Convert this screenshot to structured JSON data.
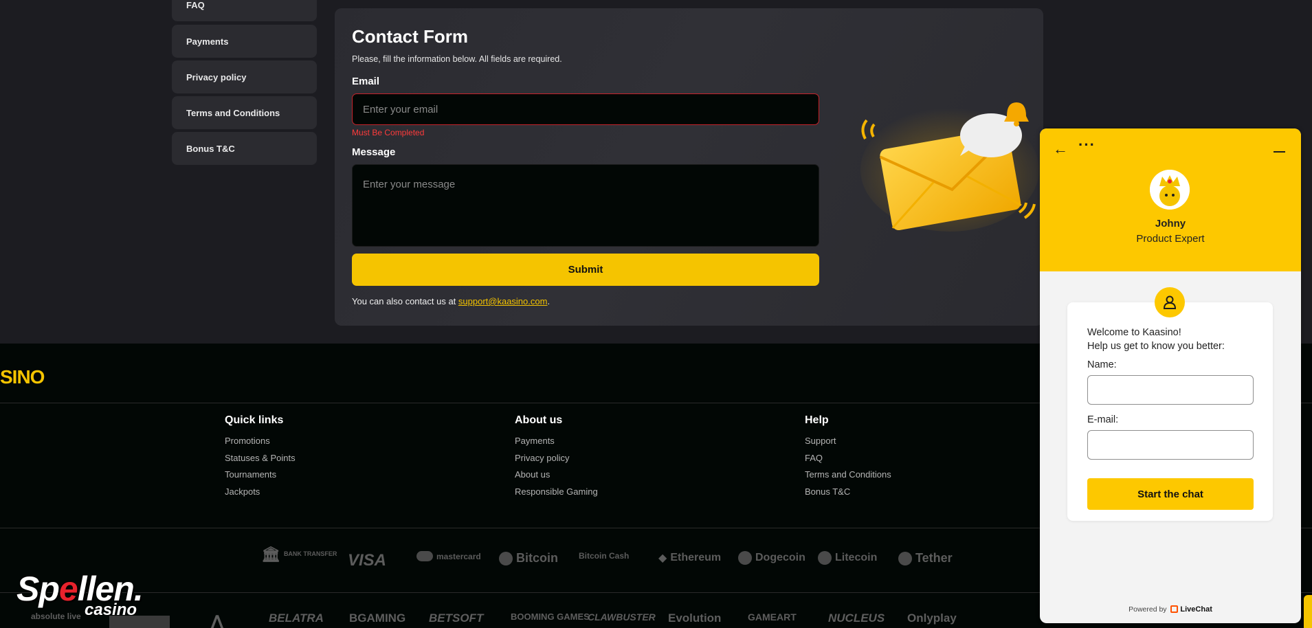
{
  "sidebar": {
    "items": [
      {
        "label": "FAQ"
      },
      {
        "label": "Payments"
      },
      {
        "label": "Privacy policy"
      },
      {
        "label": "Terms and Conditions"
      },
      {
        "label": "Bonus T&C"
      }
    ]
  },
  "contact_form": {
    "title": "Contact Form",
    "intro": "Please, fill the information below. All fields are required.",
    "email_label": "Email",
    "email_placeholder": "Enter your email",
    "email_error": "Must Be Completed",
    "message_label": "Message",
    "message_placeholder": "Enter your message",
    "submit_label": "Submit",
    "contact_note_prefix": "You can also contact us at ",
    "contact_email": "support@kaasino.com",
    "contact_note_suffix": "."
  },
  "footer": {
    "logo_text": "SINO",
    "columns": [
      {
        "title": "Quick links",
        "links": [
          "Promotions",
          "Statuses & Points",
          "Tournaments",
          "Jackpots"
        ]
      },
      {
        "title": "About us",
        "links": [
          "Payments",
          "Privacy policy",
          "About us",
          "Responsible Gaming"
        ]
      },
      {
        "title": "Help",
        "links": [
          "Support",
          "FAQ",
          "Terms and Conditions",
          "Bonus T&C"
        ]
      }
    ],
    "payment_methods": [
      "BANK TRANSFER",
      "VISA",
      "mastercard",
      "Bitcoin",
      "Bitcoin Cash",
      "Ethereum",
      "Dogecoin",
      "Litecoin",
      "Tether"
    ],
    "providers": [
      "absolute live",
      "BELATRA",
      "BGAMING",
      "BETSOFT",
      "BOOMING GAMES",
      "CLAWBUSTER",
      "Evolution",
      "GAMEART",
      "NUCLEUS",
      "Onlyplay"
    ]
  },
  "chat": {
    "agent_name": "Johny",
    "agent_role": "Product Expert",
    "welcome_line1": "Welcome to Kaasino!",
    "welcome_line2": "Help us get to know you better:",
    "name_label": "Name:",
    "email_label": "E-mail:",
    "start_button": "Start the chat",
    "powered_by": "Powered by",
    "powered_brand": "LiveChat",
    "icons": {
      "back": "arrow-left-icon",
      "more": "more-dots-icon",
      "minimize": "minimize-icon",
      "user": "user-icon"
    }
  },
  "overlay": {
    "brand_part1": "Sp",
    "brand_red": "e",
    "brand_part2": "llen.",
    "brand_sub": "casino"
  },
  "colors": {
    "accent": "#f5c400",
    "chat_accent": "#fdc800",
    "error": "#ff3b3b",
    "page_bg": "#1c1c21",
    "footer_bg": "#020705"
  }
}
